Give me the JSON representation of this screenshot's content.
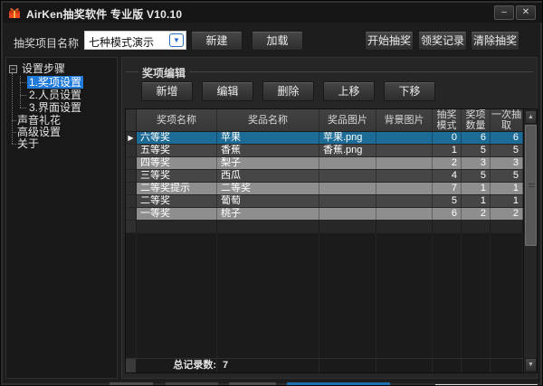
{
  "window": {
    "title": "AirKen抽奖软件 专业版 V10.10"
  },
  "icons": {
    "minimize": "–",
    "close": "✕",
    "tree_expander": "−",
    "combo_dropdown": "▼",
    "row_marker": "▶",
    "scroll_up": "▲",
    "scroll_down": "▼"
  },
  "toolbar": {
    "project_label": "抽奖项目名称",
    "project_name": "七种模式演示",
    "new": "新建",
    "load": "加载",
    "start": "开始抽奖",
    "records": "领奖记录",
    "clear": "清除抽奖"
  },
  "sidebar": {
    "root": "设置步骤",
    "children": [
      {
        "label": "1.奖项设置",
        "selected": true
      },
      {
        "label": "2.人员设置",
        "selected": false
      },
      {
        "label": "3.界面设置",
        "selected": false
      }
    ],
    "items": [
      {
        "label": "声音礼花"
      },
      {
        "label": "高级设置"
      },
      {
        "label": "关于"
      }
    ]
  },
  "main": {
    "group_title": "奖项编辑",
    "actions": {
      "add": "新增",
      "edit": "编辑",
      "delete": "删除",
      "move_up": "上移",
      "move_down": "下移"
    },
    "table": {
      "columns": [
        "奖项名称",
        "奖品名称",
        "奖品图片",
        "背景图片",
        "抽奖模式",
        "奖项数量",
        "一次抽取"
      ],
      "rows": [
        {
          "name": "六等奖",
          "prize": "苹果",
          "prize_image": "苹果.png",
          "bg_image": "",
          "mode": "0",
          "quantity": "6",
          "per_draw": "6"
        },
        {
          "name": "五等奖",
          "prize": "香蕉",
          "prize_image": "香蕉.png",
          "bg_image": "",
          "mode": "1",
          "quantity": "5",
          "per_draw": "5"
        },
        {
          "name": "四等奖",
          "prize": "梨子",
          "prize_image": "",
          "bg_image": "",
          "mode": "2",
          "quantity": "3",
          "per_draw": "3"
        },
        {
          "name": "三等奖",
          "prize": "西瓜",
          "prize_image": "",
          "bg_image": "",
          "mode": "4",
          "quantity": "5",
          "per_draw": "5"
        },
        {
          "name": "二等奖提示",
          "prize": "二等奖",
          "prize_image": "",
          "bg_image": "",
          "mode": "7",
          "quantity": "1",
          "per_draw": "1"
        },
        {
          "name": "二等奖",
          "prize": "葡萄",
          "prize_image": "",
          "bg_image": "",
          "mode": "5",
          "quantity": "1",
          "per_draw": "1"
        },
        {
          "name": "一等奖",
          "prize": "桃子",
          "prize_image": "",
          "bg_image": "",
          "mode": "6",
          "quantity": "2",
          "per_draw": "2"
        }
      ],
      "selected_row": "六等奖",
      "footer": {
        "label": "总记录数:",
        "value": "7"
      }
    }
  },
  "colors": {
    "tree_selection": "#1f7ad9",
    "row_selected": "#1d6c97",
    "row_dark": "#464646",
    "row_light": "#8e8e8e",
    "accent_red": "#e8491f"
  }
}
